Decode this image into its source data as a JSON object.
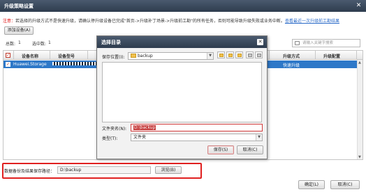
{
  "window": {
    "title": "升级策略设置"
  },
  "notice": {
    "prefix": "注意：",
    "text": "若选择的升级方式不是快速升级，请确认停升级设备已完成\"首页->升级补丁场景->升级前工勘\"的所有任务，否则可能导致升级失败或业务中断。",
    "link": "查看最近一次升级前工勘结果"
  },
  "toolbar": {
    "add_device_label": "添加设备(A)"
  },
  "stats": {
    "total_label": "总数:",
    "total_value": "1",
    "selected_label": "选中数:",
    "selected_value": "1"
  },
  "search": {
    "placeholder": "请输入关键字搜索"
  },
  "table": {
    "columns": [
      "设备名称",
      "设备型号",
      "升级方式",
      "升级配置"
    ],
    "rows": [
      {
        "name": "Huawei.Storage",
        "upgrade_mode": "快速升级",
        "config": ""
      }
    ]
  },
  "backup_path": {
    "label": "数据备份及结果保存路径：",
    "value": "D:\\backup",
    "browse_label": "浏览(B)"
  },
  "footer": {
    "ok_label": "确定(L)",
    "cancel_label": "取消(C)"
  },
  "dialog": {
    "title": "选择目录",
    "location_label": "保存位置(I):",
    "location_value": "backup",
    "filename_label": "文件夹名(N):",
    "filename_value": "D:\\backup",
    "type_label": "类型(T):",
    "type_value": "文件夹",
    "save_label": "保存(S)",
    "cancel_label": "取消(C)"
  },
  "colors": {
    "titlebar": "#33414f",
    "selected_row": "#2e78c8",
    "highlight_red": "#e02020",
    "link": "#2a6ac8",
    "notice_red": "#dd0000"
  }
}
